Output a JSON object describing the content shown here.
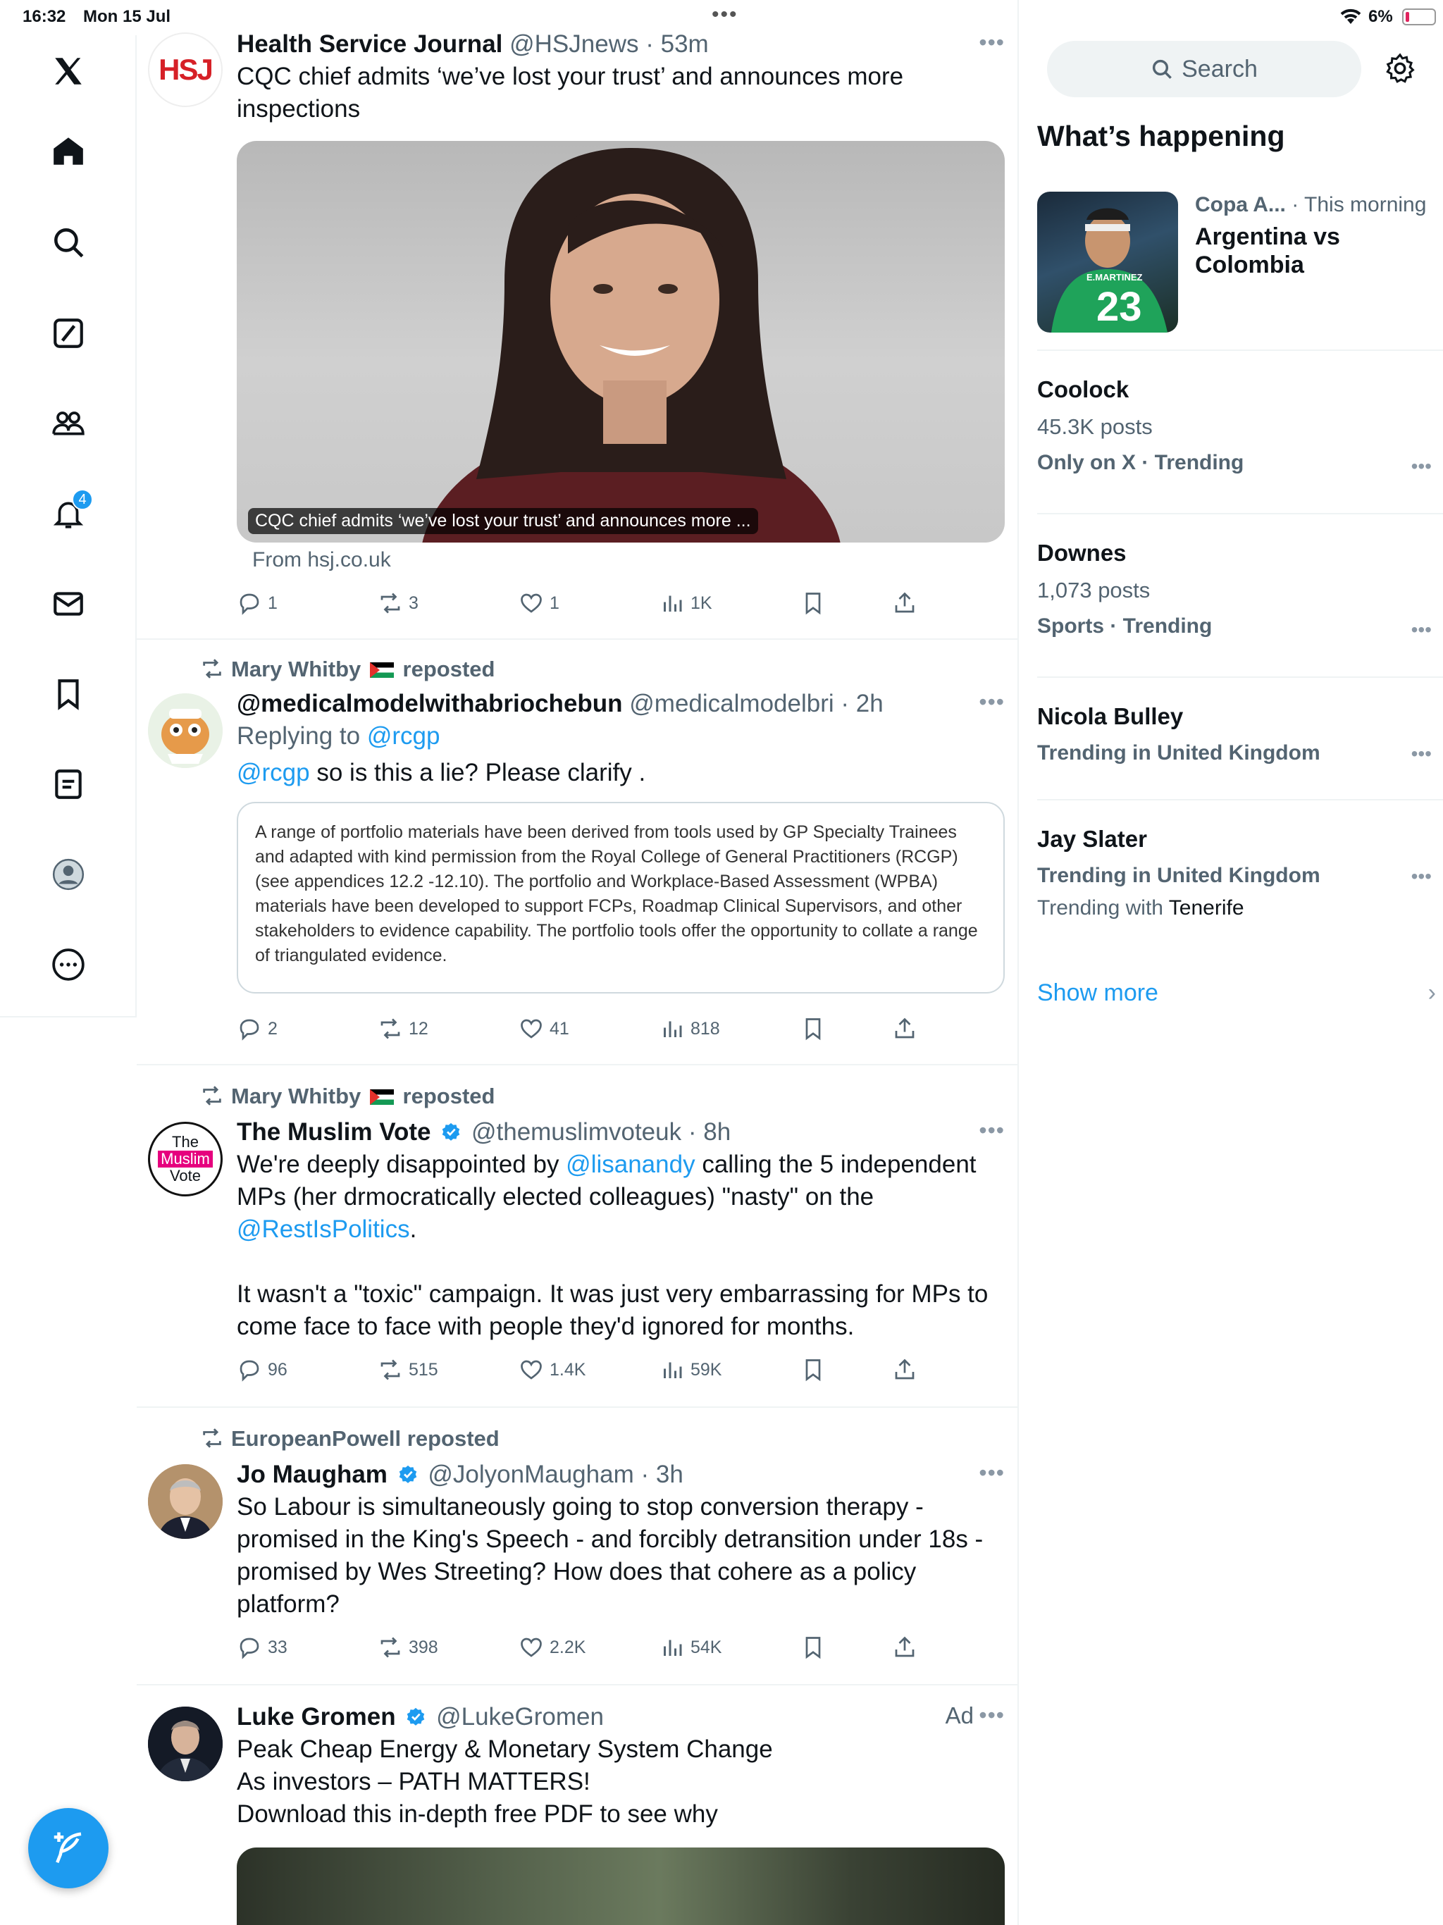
{
  "status_bar": {
    "time": "16:32",
    "date": "Mon 15 Jul",
    "battery": "6%"
  },
  "nav": {
    "notifications_badge": "4"
  },
  "tweets": [
    {
      "name": "Health Service Journal",
      "handle": "@HSJnews",
      "time": "53m",
      "avatar_text": "HSJ",
      "text": "CQC chief admits ‘we’ve lost your trust’ and announces more inspections",
      "card_caption": "CQC chief admits ‘we’ve lost your trust’ and announces more ...",
      "card_source": "From hsj.co.uk",
      "replies": "1",
      "reposts": "3",
      "likes": "1",
      "views": "1K"
    },
    {
      "reposted_by": "Mary Whitby",
      "reposted_label": "reposted",
      "name": "@medicalmodelwithabriochebun",
      "handle": "@medicalmodelbri",
      "time": "2h",
      "replying_label": "Replying to",
      "replying_to": "@rcgp",
      "mention": "@rcgp",
      "text": " so is this a lie? Please clarify .",
      "quote": "A range of portfolio materials have been derived from tools used by GP Specialty Trainees and adapted with kind permission from the Royal College of General Practitioners (RCGP) (see appendices 12.2 -12.10). The portfolio and Workplace-Based Assessment (WPBA) materials have been developed to support FCPs, Roadmap Clinical Supervisors, and other stakeholders to evidence capability. The portfolio tools offer the opportunity to collate a range of triangulated evidence.",
      "replies": "2",
      "reposts": "12",
      "likes": "41",
      "views": "818"
    },
    {
      "reposted_by": "Mary Whitby",
      "reposted_label": "reposted",
      "name": "The Muslim Vote",
      "handle": "@themuslimvoteuk",
      "time": "8h",
      "avatar_lines": [
        "The",
        "Muslim",
        "Vote"
      ],
      "text_1": "We're deeply disappointed by ",
      "link_1": "@lisanandy",
      "text_2": " calling the 5 independent MPs (her drmocratically elected colleagues) \"nasty\" on the ",
      "link_2": "@RestIsPolitics",
      "text_3": ".",
      "text_4": "It wasn't a \"toxic\" campaign. It was just very embarrassing for MPs to come face to face with people they'd ignored for months.",
      "replies": "96",
      "reposts": "515",
      "likes": "1.4K",
      "views": "59K"
    },
    {
      "reposted_by": "EuropeanPowell",
      "reposted_label": "reposted",
      "name": "Jo Maugham",
      "handle": "@JolyonMaugham",
      "time": "3h",
      "text": "So Labour is simultaneously going to stop conversion therapy - promised in the King's Speech - and forcibly detransition under 18s - promised by Wes Streeting? How does that cohere as a policy platform?",
      "replies": "33",
      "reposts": "398",
      "likes": "2.2K",
      "views": "54K"
    },
    {
      "name": "Luke Gromen",
      "handle": "@LukeGromen",
      "ad_label": "Ad",
      "line_1": "Peak Cheap Energy & Monetary System Change",
      "line_2": "As investors – PATH MATTERS!",
      "line_3": "Download this in-depth free PDF to see why"
    }
  ],
  "sidebar": {
    "search_placeholder": "Search",
    "whats_happening": "What’s happening",
    "event": {
      "category": "Copa A...",
      "time": " · This morning",
      "title": "Argentina vs Colombia",
      "jersey_name": "E.MARTINEZ",
      "jersey_number": "23"
    },
    "trends": [
      {
        "title": "Coolock",
        "posts": "45.3K posts",
        "meta": "Only on X · Trending"
      },
      {
        "title": "Downes",
        "posts": "1,073 posts",
        "meta": "Sports · Trending"
      },
      {
        "title": "Nicola Bulley",
        "meta": "Trending in United Kingdom"
      },
      {
        "title": "Jay Slater",
        "meta": "Trending in United Kingdom",
        "with_label": "Trending with ",
        "with_value": "Tenerife"
      }
    ],
    "show_more": "Show more"
  },
  "colors": {
    "accent": "#1d9bf0",
    "text": "#0f1419",
    "muted": "#536471",
    "border": "#eff3f4"
  }
}
